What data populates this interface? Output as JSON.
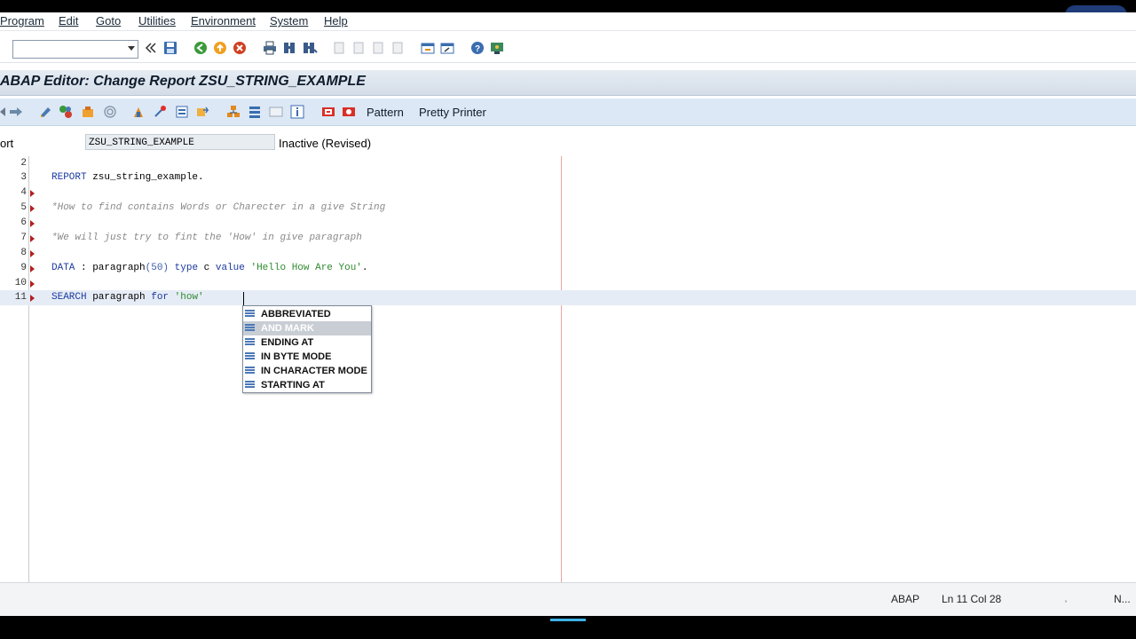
{
  "menu": {
    "items": [
      {
        "label": "Program"
      },
      {
        "label": "Edit"
      },
      {
        "label": "Goto"
      },
      {
        "label": "Utilities"
      },
      {
        "label": "Environment"
      },
      {
        "label": "System"
      },
      {
        "label": "Help"
      }
    ]
  },
  "command_field": {
    "value": ""
  },
  "window_title": "ABAP Editor: Change Report ZSU_STRING_EXAMPLE",
  "app_toolbar": {
    "pattern_label": "Pattern",
    "pretty_printer_label": "Pretty Printer"
  },
  "report_row": {
    "label": "ort",
    "report_name": "ZSU_STRING_EXAMPLE",
    "status": "Inactive (Revised)"
  },
  "editor": {
    "lines": [
      {
        "num": "2",
        "marker": false,
        "parts": []
      },
      {
        "num": "3",
        "marker": false,
        "parts": [
          {
            "cls": "kw",
            "text": "REPORT"
          },
          {
            "cls": "",
            "text": " zsu_string_example."
          }
        ]
      },
      {
        "num": "4",
        "marker": true,
        "parts": []
      },
      {
        "num": "5",
        "marker": true,
        "parts": [
          {
            "cls": "cmt",
            "text": "*How to find contains Words or Charecter in a give String"
          }
        ]
      },
      {
        "num": "6",
        "marker": true,
        "parts": []
      },
      {
        "num": "7",
        "marker": true,
        "parts": [
          {
            "cls": "cmt",
            "text": "*We will just try to fint the 'How' in give paragraph"
          }
        ]
      },
      {
        "num": "8",
        "marker": true,
        "parts": []
      },
      {
        "num": "9",
        "marker": true,
        "parts": [
          {
            "cls": "kw",
            "text": "DATA"
          },
          {
            "cls": "",
            "text": " : paragraph"
          },
          {
            "cls": "num",
            "text": "(50)"
          },
          {
            "cls": "",
            "text": " "
          },
          {
            "cls": "kw",
            "text": "type"
          },
          {
            "cls": "",
            "text": " c "
          },
          {
            "cls": "kw",
            "text": "value"
          },
          {
            "cls": "",
            "text": " "
          },
          {
            "cls": "str",
            "text": "'Hello How Are You'"
          },
          {
            "cls": "",
            "text": "."
          }
        ]
      },
      {
        "num": "10",
        "marker": true,
        "parts": []
      },
      {
        "num": "11",
        "marker": true,
        "current": true,
        "parts": [
          {
            "cls": "kw",
            "text": "SEARCH"
          },
          {
            "cls": "",
            "text": " paragraph "
          },
          {
            "cls": "kw",
            "text": "for"
          },
          {
            "cls": "",
            "text": " "
          },
          {
            "cls": "str",
            "text": "'how'"
          }
        ]
      }
    ]
  },
  "autocomplete": {
    "items": [
      {
        "label": "ABBREVIATED",
        "selected": false
      },
      {
        "label": "AND MARK",
        "selected": true
      },
      {
        "label": "ENDING AT",
        "selected": false
      },
      {
        "label": "IN BYTE MODE",
        "selected": false
      },
      {
        "label": "IN CHARACTER MODE",
        "selected": false
      },
      {
        "label": "STARTING AT",
        "selected": false
      }
    ]
  },
  "status_bar": {
    "language": "ABAP",
    "position": "Ln  11 Col  28",
    "mode": "N..."
  }
}
